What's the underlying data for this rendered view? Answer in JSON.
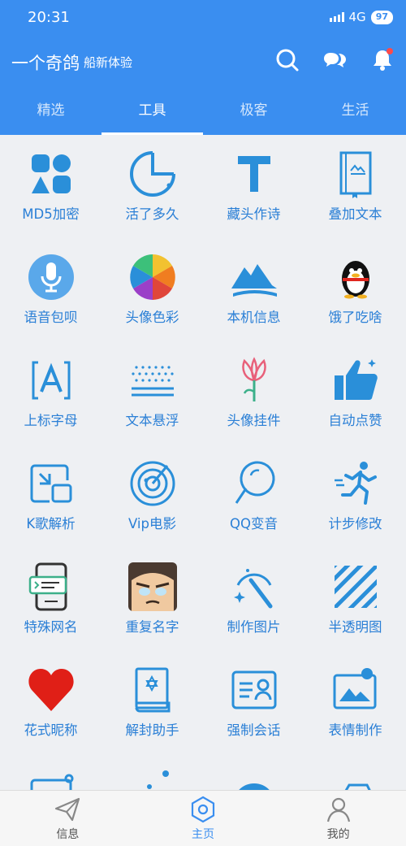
{
  "status": {
    "time": "20:31",
    "network": "4G",
    "battery": "97"
  },
  "header": {
    "title": "一个奇鸽",
    "subtitle": "船新体验",
    "tabs": [
      {
        "label": "精选",
        "active": false
      },
      {
        "label": "工具",
        "active": true
      },
      {
        "label": "极客",
        "active": false
      },
      {
        "label": "生活",
        "active": false
      }
    ]
  },
  "tools": [
    {
      "label": "MD5加密",
      "icon": "shapes-icon"
    },
    {
      "label": "活了多久",
      "icon": "pie-chart-icon"
    },
    {
      "label": "藏头作诗",
      "icon": "letter-t-icon"
    },
    {
      "label": "叠加文本",
      "icon": "book-icon"
    },
    {
      "label": "语音包呗",
      "icon": "microphone-icon"
    },
    {
      "label": "头像色彩",
      "icon": "color-wheel-icon"
    },
    {
      "label": "本机信息",
      "icon": "mountain-icon"
    },
    {
      "label": "饿了吃啥",
      "icon": "penguin-icon"
    },
    {
      "label": "上标字母",
      "icon": "letter-a-bracket-icon"
    },
    {
      "label": "文本悬浮",
      "icon": "floating-dots-icon"
    },
    {
      "label": "头像挂件",
      "icon": "flower-icon"
    },
    {
      "label": "自动点赞",
      "icon": "thumbs-up-icon"
    },
    {
      "label": "K歌解析",
      "icon": "picture-in-picture-icon"
    },
    {
      "label": "Vip电影",
      "icon": "radar-icon"
    },
    {
      "label": "QQ变音",
      "icon": "mirror-icon"
    },
    {
      "label": "计步修改",
      "icon": "runner-icon"
    },
    {
      "label": "特殊网名",
      "icon": "phone-message-icon"
    },
    {
      "label": "重复名字",
      "icon": "cartoon-face-icon"
    },
    {
      "label": "制作图片",
      "icon": "magic-wand-icon"
    },
    {
      "label": "半透明图",
      "icon": "stripes-icon"
    },
    {
      "label": "花式昵称",
      "icon": "heart-icon"
    },
    {
      "label": "解封助手",
      "icon": "star-book-icon"
    },
    {
      "label": "强制会话",
      "icon": "id-card-icon"
    },
    {
      "label": "表情制作",
      "icon": "photo-frame-icon"
    }
  ],
  "bottom_nav": [
    {
      "label": "信息",
      "icon": "paper-plane-icon",
      "active": false
    },
    {
      "label": "主页",
      "icon": "hexagon-icon",
      "active": true
    },
    {
      "label": "我的",
      "icon": "user-icon",
      "active": false
    }
  ],
  "colors": {
    "primary": "#3a8ef0",
    "label": "#2a7fd6",
    "background": "#eef0f3"
  }
}
